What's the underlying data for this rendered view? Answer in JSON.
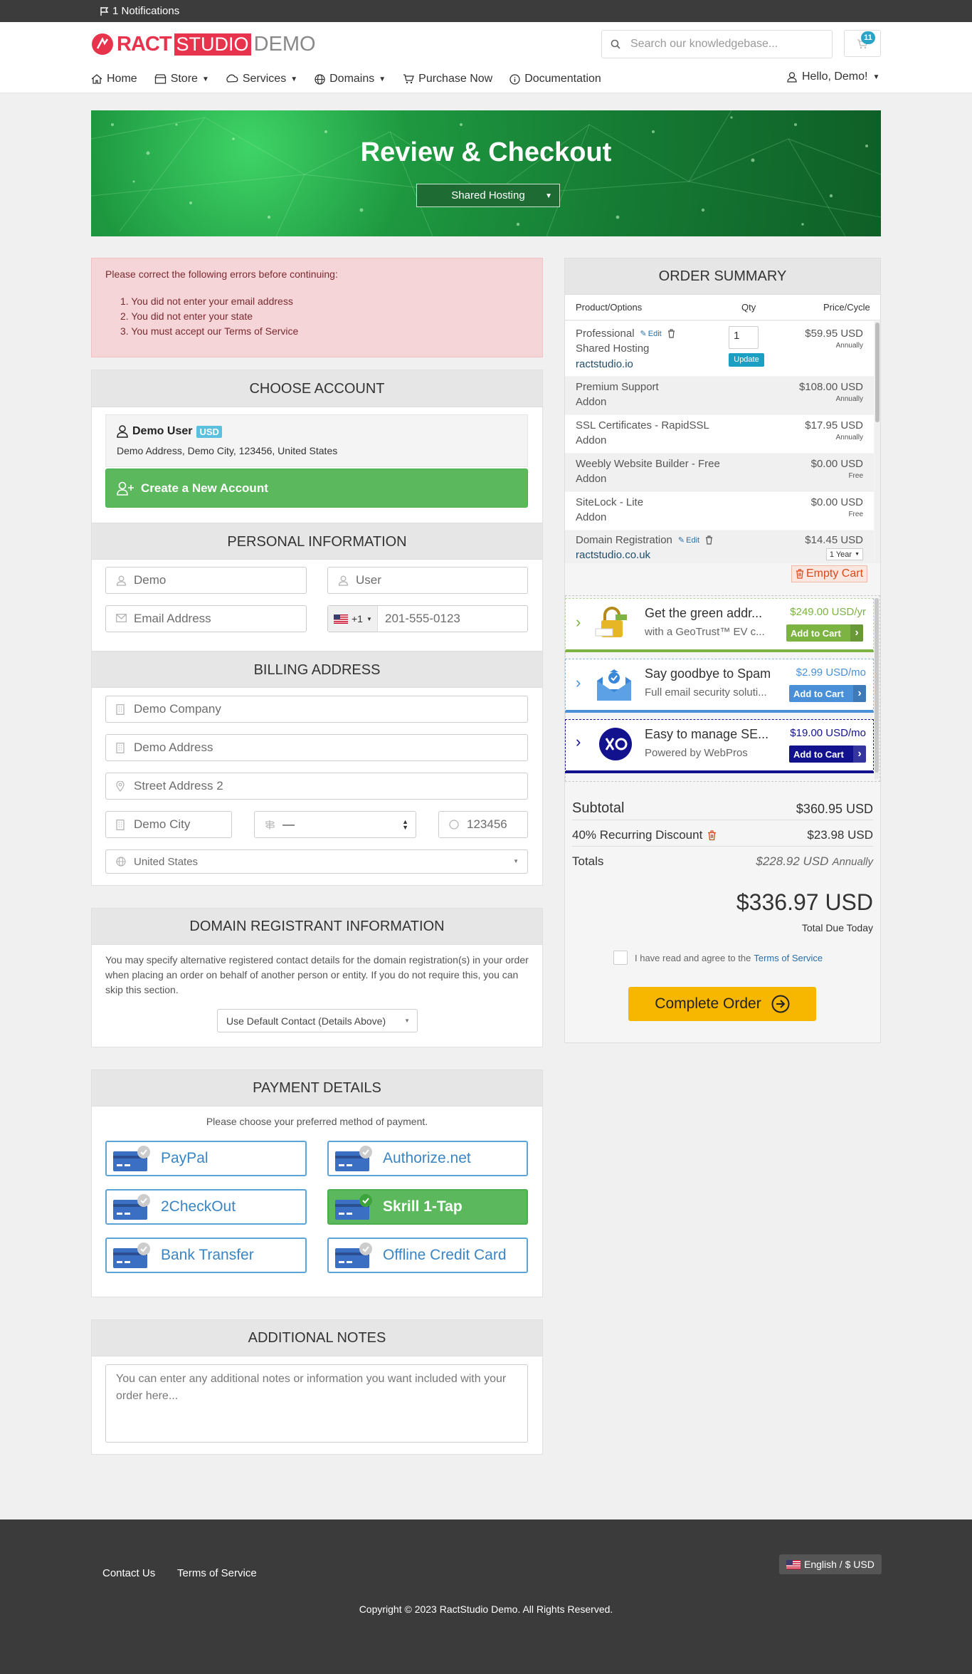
{
  "topbar": {
    "notifications": "1 Notifications"
  },
  "header": {
    "logo": {
      "part1": "RACT",
      "part2": "STUDIO",
      "part3": "DEMO"
    },
    "search_placeholder": "Search our knowledgebase...",
    "cart_count": "11"
  },
  "nav": {
    "items": [
      {
        "label": "Home",
        "icon": "home-icon"
      },
      {
        "label": "Store",
        "icon": "store-icon",
        "dropdown": true
      },
      {
        "label": "Services",
        "icon": "services-icon",
        "dropdown": true
      },
      {
        "label": "Domains",
        "icon": "globe-icon",
        "dropdown": true
      },
      {
        "label": "Purchase Now",
        "icon": "cart-icon"
      },
      {
        "label": "Documentation",
        "icon": "info-icon"
      }
    ],
    "account": "Hello, Demo!"
  },
  "hero": {
    "title": "Review & Checkout",
    "select": "Shared Hosting"
  },
  "errors": {
    "heading": "Please correct the following errors before continuing:",
    "items": [
      "You did not enter your email address",
      "You did not enter your state",
      "You must accept our Terms of Service"
    ]
  },
  "choose_account": {
    "title": "CHOOSE ACCOUNT",
    "user_name": "Demo User",
    "currency": "USD",
    "address": "Demo Address, Demo City, 123456, United States",
    "create_label": "Create a New Account"
  },
  "personal": {
    "title": "PERSONAL INFORMATION",
    "first_name": "Demo",
    "last_name": "User",
    "email_placeholder": "Email Address",
    "phone_code": "+1",
    "phone": "201-555-0123"
  },
  "billing": {
    "title": "BILLING ADDRESS",
    "company": "Demo Company",
    "address1": "Demo Address",
    "address2_placeholder": "Street Address 2",
    "city": "Demo City",
    "state": "—",
    "postcode": "123456",
    "country": "United States"
  },
  "domain_registrant": {
    "title": "DOMAIN REGISTRANT INFORMATION",
    "text": "You may specify alternative registered contact details for the domain registration(s) in your order when placing an order on behalf of another person or entity. If you do not require this, you can skip this section.",
    "select": "Use Default Contact (Details Above)"
  },
  "payment": {
    "title": "PAYMENT DETAILS",
    "prompt": "Please choose your preferred method of payment.",
    "methods": [
      "PayPal",
      "Authorize.net",
      "2CheckOut",
      "Skrill 1-Tap",
      "Bank Transfer",
      "Offline Credit Card"
    ],
    "selected": "Skrill 1-Tap"
  },
  "notes": {
    "title": "ADDITIONAL NOTES",
    "placeholder": "You can enter any additional notes or information you want included with your order here..."
  },
  "summary": {
    "title": "ORDER SUMMARY",
    "col_product": "Product/Options",
    "col_qty": "Qty",
    "col_price": "Price/Cycle",
    "edit_label": "Edit",
    "update_label": "Update",
    "qty": "1",
    "items": [
      {
        "name": "Professional",
        "sub": "Shared Hosting",
        "domain": "ractstudio.io",
        "price": "$59.95 USD",
        "cycle": "Annually"
      },
      {
        "name": "Premium Support",
        "sub": "Addon",
        "price": "$108.00 USD",
        "cycle": "Annually"
      },
      {
        "name": "SSL Certificates - RapidSSL",
        "sub": "Addon",
        "price": "$17.95 USD",
        "cycle": "Annually"
      },
      {
        "name": "Weebly Website Builder - Free",
        "sub": "Addon",
        "price": "$0.00 USD",
        "cycle": "Free"
      },
      {
        "name": "SiteLock - Lite",
        "sub": "Addon",
        "price": "$0.00 USD",
        "cycle": "Free"
      },
      {
        "name": "Domain Registration",
        "domain": "ractstudio.co.uk",
        "price": "$14.45 USD",
        "cycle": "1 Year"
      }
    ],
    "empty_cart": "Empty Cart",
    "upsells": [
      {
        "title": "Get the green addr...",
        "desc": "with a GeoTrust™ EV c...",
        "price": "$249.00 USD/yr",
        "btn": "Add to Cart",
        "color": "#7cb342"
      },
      {
        "title": "Say goodbye to Spam",
        "desc": "Full email security soluti...",
        "price": "$2.99 USD/mo",
        "btn": "Add to Cart",
        "color": "#4a90d9"
      },
      {
        "title": "Easy to manage SE...",
        "desc": "Powered by WebPros",
        "price": "$19.00 USD/mo",
        "btn": "Add to Cart",
        "color": "#12128f"
      }
    ],
    "subtotal_label": "Subtotal",
    "subtotal": "$360.95 USD",
    "discount_label": "40% Recurring Discount",
    "discount": "$23.98 USD",
    "totals_label": "Totals",
    "totals": "$228.92 USD",
    "totals_cycle": "Annually",
    "due": "$336.97 USD",
    "due_label": "Total Due Today",
    "tos_prefix": "I have read and agree to the",
    "tos_link": "Terms of Service",
    "complete": "Complete Order"
  },
  "footer": {
    "links": [
      "Contact Us",
      "Terms of Service"
    ],
    "lang": "English / $ USD",
    "copyright": "Copyright © 2023 RactStudio Demo. All Rights Reserved."
  }
}
